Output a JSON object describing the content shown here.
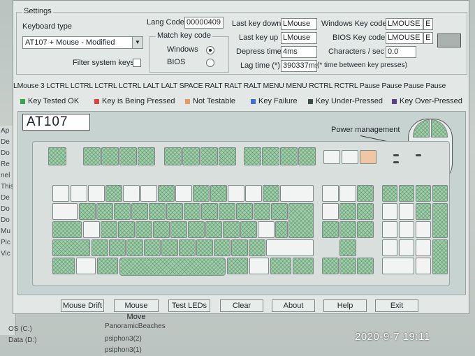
{
  "left_strip": [
    "Ap",
    "De",
    "Do",
    "Re",
    "nel",
    "This",
    "De",
    "Do",
    "Do",
    "Mu",
    "Pic",
    "Vic"
  ],
  "settings": {
    "legend": "Settings",
    "keyboard_type_label": "Keyboard type",
    "keyboard_type_value": "AT107 + Mouse - Modified",
    "filter_label": "Filter system keys",
    "lang_code_label": "Lang Code",
    "lang_code_value": "00000409",
    "match_legend": "Match key code",
    "windows_label": "Windows",
    "bios_label": "BIOS",
    "last_key_down_label": "Last key down",
    "last_key_down_value": "LMouse",
    "last_key_up_label": "Last key up",
    "last_key_up_value": "LMouse",
    "depress_time_label": "Depress time",
    "depress_time_value": "4ms",
    "lag_time_label": "Lag time (*)",
    "lag_time_value": "390337ms",
    "lag_note": "(* time between key presses)",
    "win_key_code_label": "Windows Key code",
    "win_key_code_value": "LMOUSE",
    "win_key_code_suffix": "E",
    "bios_key_code_label": "BIOS Key code",
    "bios_key_code_value": "LMOUSE",
    "bios_key_code_suffix": "E",
    "chars_sec_label": "Characters / sec",
    "chars_sec_value": "0.0"
  },
  "history_strip": "LMouse 3 LCTRL LCTRL LCTRL LCTRL LALT LALT SPACE RALT RALT RALT MENU MENU RCTRL RCTRL Pause Pause Pause Pause",
  "legend": [
    {
      "label": "Key Tested OK",
      "color": "#3aa64a"
    },
    {
      "label": "Key is Being Pressed",
      "color": "#d9443f"
    },
    {
      "label": "Not Testable",
      "color": "#e89a5a"
    },
    {
      "label": "Key Failure",
      "color": "#3f6fd6"
    },
    {
      "label": "Key Under-Pressed",
      "color": "#3f4b48"
    },
    {
      "label": "Key Over-Pressed",
      "color": "#5a3f8a"
    }
  ],
  "keyboard": {
    "title": "AT107",
    "power_label": "Power management"
  },
  "buttons": [
    "Mouse Drift",
    "Mouse Move",
    "Test LEDs",
    "Clear",
    "About",
    "Help",
    "Exit"
  ],
  "below_items": [
    "OS (C:)",
    "Data (D:)",
    "PanoramicBeaches",
    "psiphon3(2)",
    "psiphon3(1)"
  ],
  "timestamp": "2020-9-7  19:11"
}
